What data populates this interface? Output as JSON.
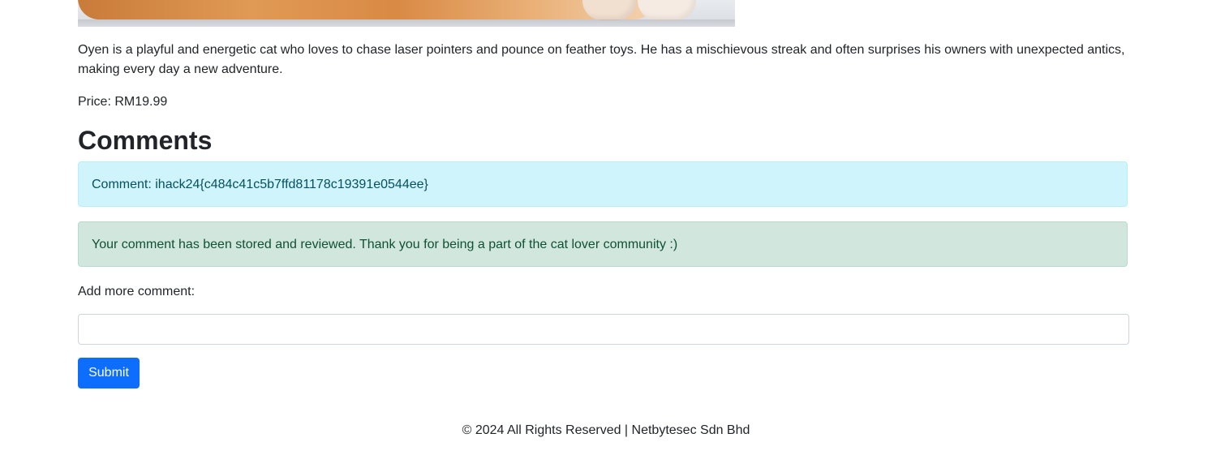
{
  "product": {
    "image_alt": "cat photo",
    "description": "Oyen is a playful and energetic cat who loves to chase laser pointers and pounce on feather toys. He has a mischievous streak and often surprises his owners with unexpected antics, making every day a new adventure.",
    "price": "Price: RM19.99"
  },
  "comments": {
    "heading": "Comments",
    "items": [
      {
        "text": "Comment: ihack24{c484c41c5b7ffd81178c19391e0544ee}"
      }
    ],
    "success_message": "Your comment has been stored and reviewed. Thank you for being a part of the cat lover community :)"
  },
  "form": {
    "label": "Add more comment:",
    "input_value": "",
    "submit_label": "Submit"
  },
  "footer": {
    "text": "© 2024 All Rights Reserved | Netbytesec Sdn Bhd"
  },
  "colors": {
    "primary": "#0d6efd",
    "info_bg": "#cff4fc",
    "success_bg": "#d1e7dd"
  }
}
